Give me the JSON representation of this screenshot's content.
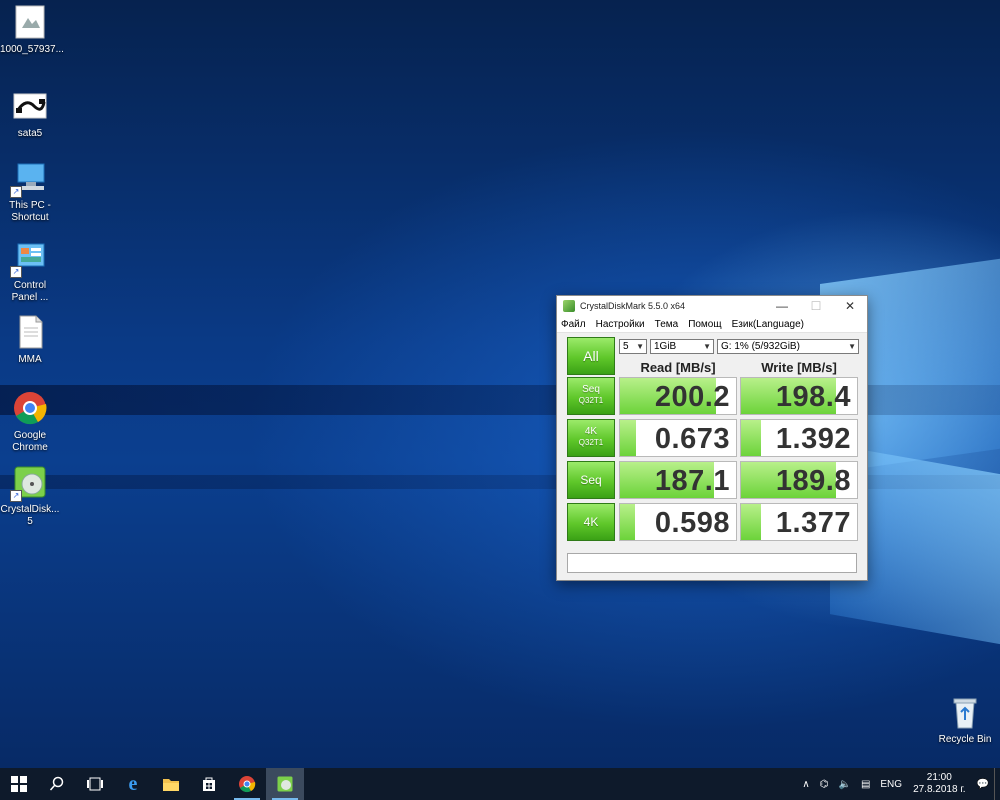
{
  "desktop": {
    "icons": [
      {
        "label": "1000_57937...",
        "icon": "image-file-icon"
      },
      {
        "label": "sata5",
        "icon": "cable-image-icon"
      },
      {
        "label": "This PC - Shortcut",
        "icon": "computer-icon"
      },
      {
        "label": "Control Panel ...",
        "icon": "control-panel-icon"
      },
      {
        "label": "MMA",
        "icon": "document-icon"
      },
      {
        "label": "Google Chrome",
        "icon": "chrome-icon"
      },
      {
        "label": "CrystalDisk... 5",
        "icon": "crystaldisk-icon"
      }
    ],
    "recycle_bin": {
      "label": "Recycle Bin",
      "icon": "recycle-bin-icon"
    }
  },
  "window": {
    "title": "CrystalDiskMark 5.5.0 x64",
    "controls": {
      "minimize": "—",
      "maximize": "☐",
      "close": "✕"
    },
    "menu": [
      "Файл",
      "Настройки",
      "Тема",
      "Помощ",
      "Език(Language)"
    ],
    "all_button": "All",
    "count_select": "5",
    "size_select": "1GiB",
    "drive_select": "G: 1% (5/932GiB)",
    "read_header": "Read [MB/s]",
    "write_header": "Write [MB/s]",
    "rows": [
      {
        "label_top": "Seq",
        "label_bottom": "Q32T1",
        "read": "200.2",
        "write": "198.4",
        "read_level": 0.83,
        "write_level": 0.82
      },
      {
        "label_top": "4K",
        "label_bottom": "Q32T1",
        "read": "0.673",
        "write": "1.392",
        "read_level": 0.14,
        "write_level": 0.17
      },
      {
        "label_top": "Seq",
        "label_bottom": "",
        "read": "187.1",
        "write": "189.8",
        "read_level": 0.81,
        "write_level": 0.82
      },
      {
        "label_top": "4K",
        "label_bottom": "",
        "read": "0.598",
        "write": "1.377",
        "read_level": 0.13,
        "write_level": 0.17
      }
    ],
    "status_text": ""
  },
  "taskbar": {
    "language": "ENG",
    "time": "21:00",
    "date": "27.8.2018 г."
  },
  "colors": {
    "accent_green": "#5fc72a",
    "taskbar": "#0e1a2b"
  }
}
